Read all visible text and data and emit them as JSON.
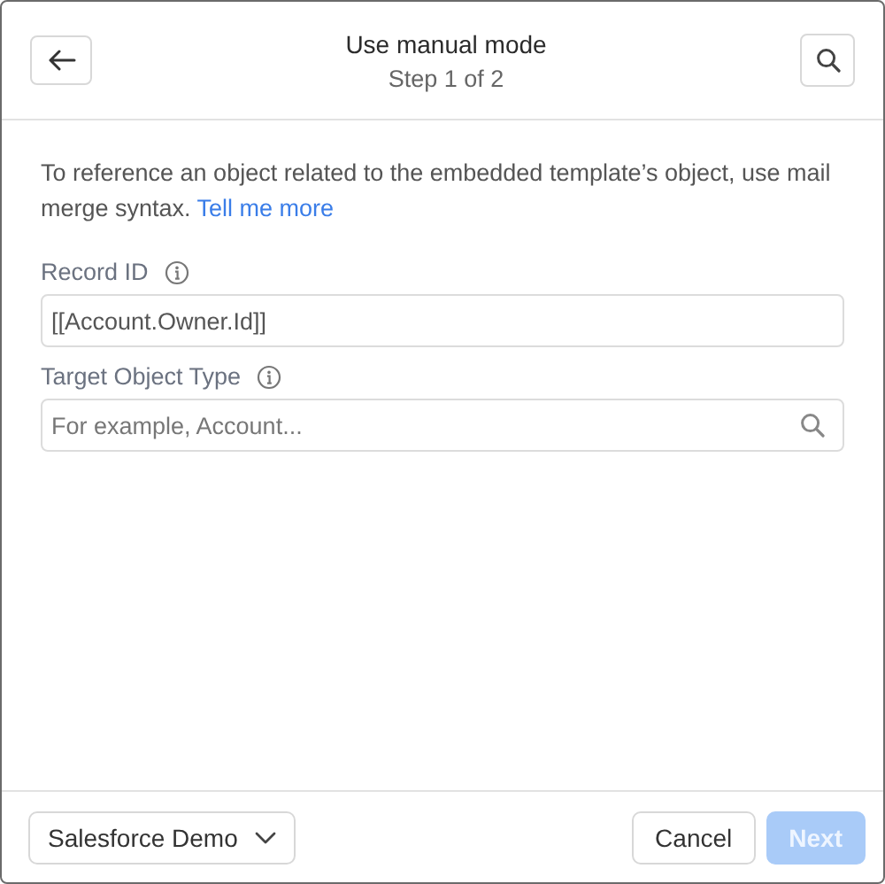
{
  "header": {
    "title": "Use manual mode",
    "subtitle": "Step 1 of 2"
  },
  "intro": {
    "text": "To reference an object related to the embedded template’s object, use mail merge syntax.",
    "link": "Tell me more"
  },
  "fields": [
    {
      "kind": "text",
      "label": "Record ID",
      "value": "[[Account.Owner.Id]]"
    },
    {
      "kind": "search",
      "label": "Target Object Type",
      "placeholder": "For example, Account..."
    }
  ],
  "footer": {
    "org_menu": "Salesforce Demo",
    "buttons": [
      {
        "kind": "neutral",
        "label": "Cancel",
        "disabled": false
      },
      {
        "kind": "brand",
        "label": "Next",
        "disabled": true
      }
    ]
  }
}
